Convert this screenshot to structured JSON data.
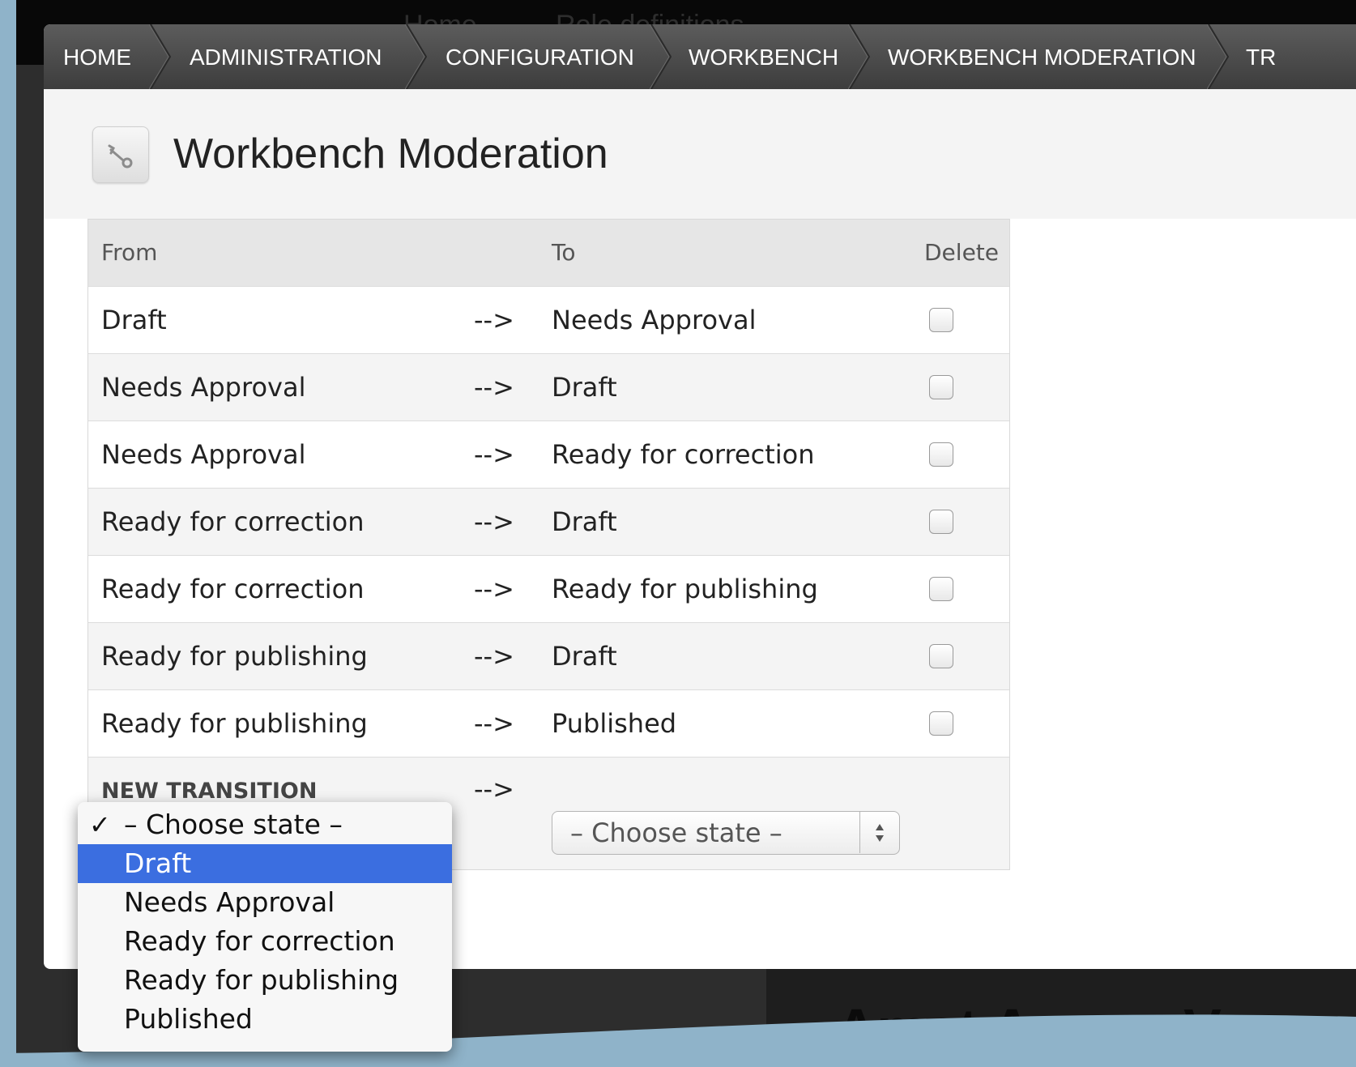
{
  "background": {
    "top_links": [
      "Home",
      "Role definitions"
    ],
    "bottom_heading": "Amet Augue Ve"
  },
  "breadcrumb": [
    "HOME",
    "ADMINISTRATION",
    "CONFIGURATION",
    "WORKBENCH",
    "WORKBENCH MODERATION",
    "TR"
  ],
  "page": {
    "title": "Workbench Moderation",
    "icon": "wrench-icon"
  },
  "table": {
    "headers": {
      "from": "From",
      "to": "To",
      "delete": "Delete"
    },
    "rows": [
      {
        "from": "Draft",
        "arrow": "-->",
        "to": "Needs Approval",
        "delete": false
      },
      {
        "from": "Needs Approval",
        "arrow": "-->",
        "to": "Draft",
        "delete": false
      },
      {
        "from": "Needs Approval",
        "arrow": "-->",
        "to": "Ready for correction",
        "delete": false
      },
      {
        "from": "Ready for correction",
        "arrow": "-->",
        "to": "Draft",
        "delete": false
      },
      {
        "from": "Ready for correction",
        "arrow": "-->",
        "to": "Ready for publishing",
        "delete": false
      },
      {
        "from": "Ready for publishing",
        "arrow": "-->",
        "to": "Draft",
        "delete": false
      },
      {
        "from": "Ready for publishing",
        "arrow": "-->",
        "to": "Published",
        "delete": false
      }
    ],
    "new_transition": {
      "label": "NEW TRANSITION",
      "arrow": "-->",
      "to_select_value": "– Choose state –"
    }
  },
  "dropdown": {
    "check_mark": "✓",
    "checked_index": 0,
    "highlighted_index": 1,
    "options": [
      "– Choose state –",
      "Draft",
      "Needs Approval",
      "Ready for correction",
      "Ready for publishing",
      "Published"
    ]
  },
  "colors": {
    "highlight": "#3b6ee0",
    "breadcrumb_bg": "#4a4a4a",
    "backdrop": "#8fb3c9"
  }
}
